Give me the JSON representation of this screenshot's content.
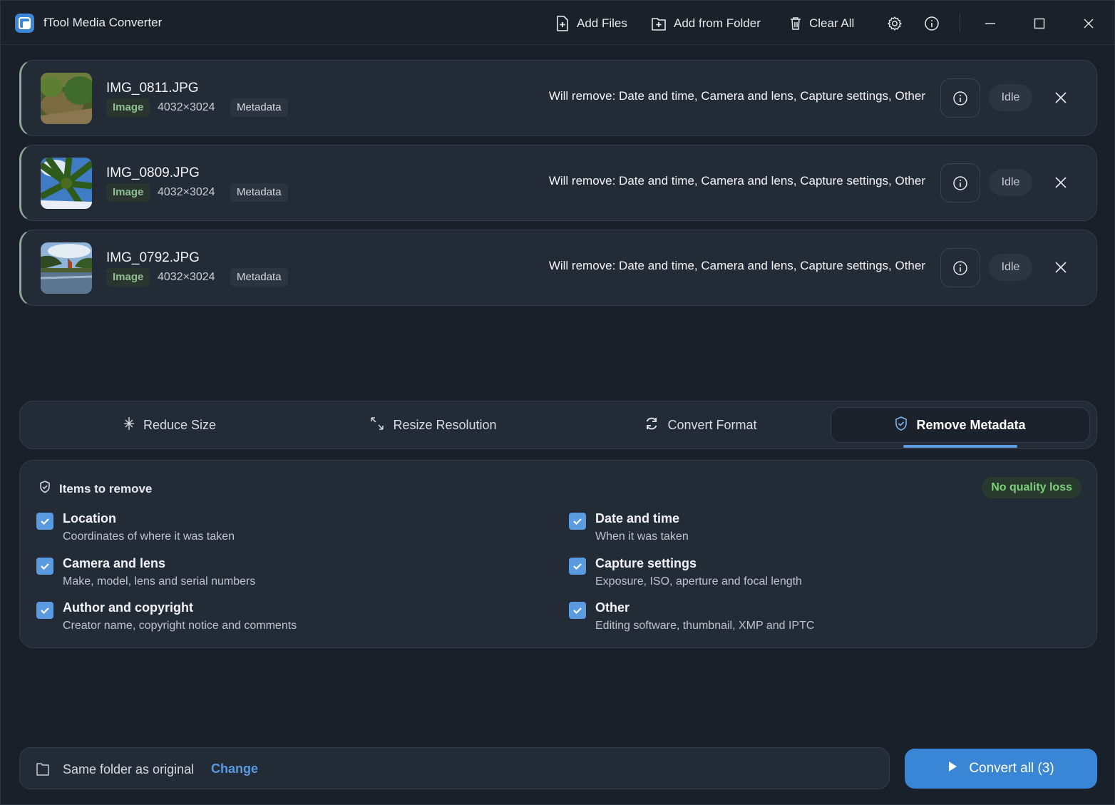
{
  "app": {
    "title": "fTool Media Converter"
  },
  "toolbar": {
    "add_files": "Add Files",
    "add_folder": "Add from Folder",
    "clear_all": "Clear All"
  },
  "files": [
    {
      "name": "IMG_0811.JPG",
      "type": "Image",
      "dims": "4032×3024",
      "meta_tag": "Metadata",
      "remove_text": "Will remove: Date and time, Camera and lens, Capture settings, Other",
      "status": "Idle"
    },
    {
      "name": "IMG_0809.JPG",
      "type": "Image",
      "dims": "4032×3024",
      "meta_tag": "Metadata",
      "remove_text": "Will remove: Date and time, Camera and lens, Capture settings, Other",
      "status": "Idle"
    },
    {
      "name": "IMG_0792.JPG",
      "type": "Image",
      "dims": "4032×3024",
      "meta_tag": "Metadata",
      "remove_text": "Will remove: Date and time, Camera and lens, Capture settings, Other",
      "status": "Idle"
    }
  ],
  "tabs": [
    {
      "label": "Reduce Size",
      "icon": "sparkle-icon"
    },
    {
      "label": "Resize Resolution",
      "icon": "resize-icon"
    },
    {
      "label": "Convert Format",
      "icon": "refresh-icon"
    },
    {
      "label": "Remove Metadata",
      "icon": "shield-icon",
      "active": true
    }
  ],
  "panel": {
    "heading": "Items to remove",
    "badge": "No quality loss",
    "options": [
      {
        "title": "Location",
        "desc": "Coordinates of where it was taken",
        "checked": true
      },
      {
        "title": "Date and time",
        "desc": "When it was taken",
        "checked": true
      },
      {
        "title": "Camera and lens",
        "desc": "Make, model, lens and serial numbers",
        "checked": true
      },
      {
        "title": "Capture settings",
        "desc": "Exposure, ISO, aperture and focal length",
        "checked": true
      },
      {
        "title": "Author and copyright",
        "desc": "Creator name, copyright notice and comments",
        "checked": true
      },
      {
        "title": "Other",
        "desc": "Editing software, thumbnail, XMP and IPTC",
        "checked": true
      }
    ]
  },
  "destination": {
    "label": "Same folder as original",
    "change": "Change"
  },
  "convert": {
    "label": "Convert all (3)"
  },
  "colors": {
    "accent": "#3a86d6",
    "success": "#7fcf7c",
    "background": "#1a2029",
    "card": "#232b36"
  }
}
